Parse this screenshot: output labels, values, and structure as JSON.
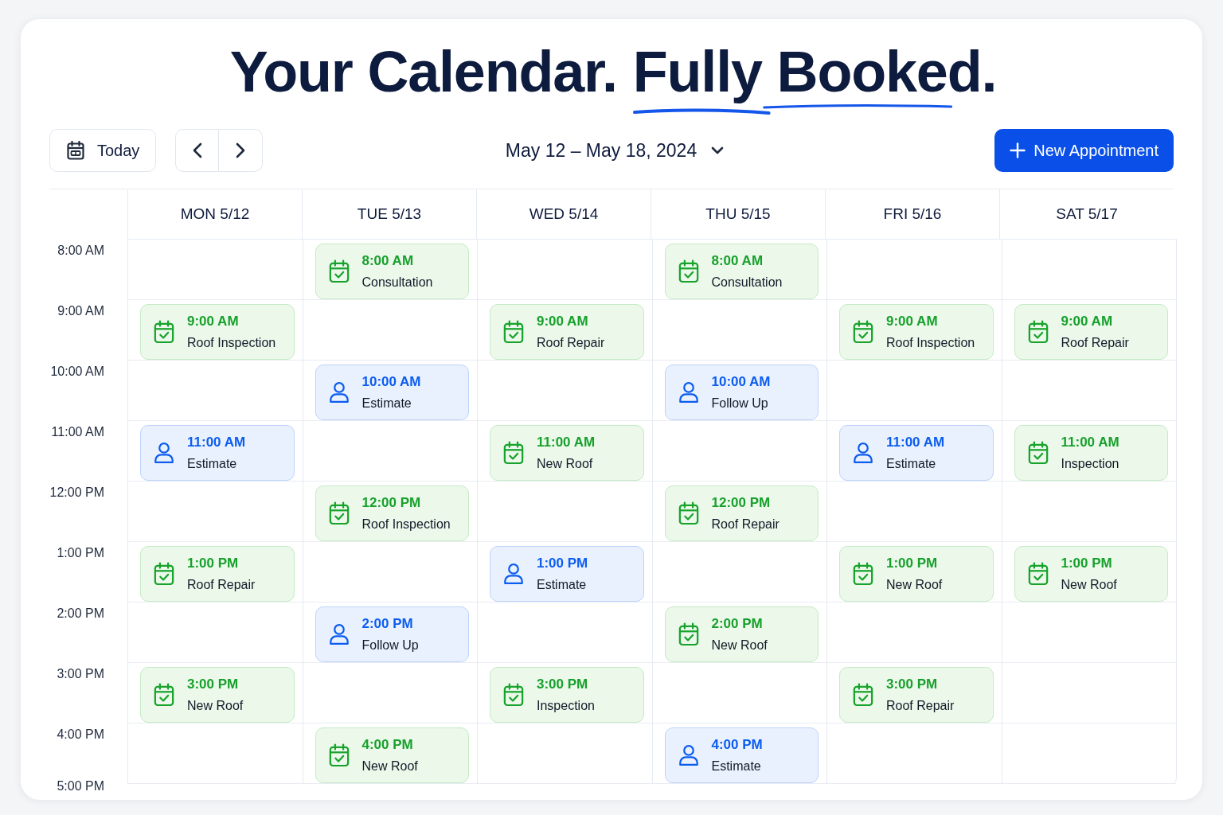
{
  "title": {
    "lead": "Your Calendar.",
    "highlight": "Fully Booked."
  },
  "toolbar": {
    "today_button": "Today",
    "date_range": "May 12 – May 18, 2024",
    "new_button": "New Appointment"
  },
  "calendar": {
    "time_labels": [
      "8:00 AM",
      "9:00 AM",
      "10:00 AM",
      "11:00 AM",
      "12:00 PM",
      "1:00 PM",
      "2:00 PM",
      "3:00 PM",
      "4:00 PM",
      "5:00 PM"
    ],
    "days": [
      {
        "label": "MON 5/12",
        "slots": [
          {
            "kind": "open"
          },
          {
            "kind": "service",
            "time": "9:00 AM",
            "title": "Roof Inspection"
          },
          {
            "kind": "open"
          },
          {
            "kind": "visit",
            "time": "11:00 AM",
            "title": "Estimate"
          },
          {
            "kind": "open"
          },
          {
            "kind": "service",
            "time": "1:00 PM",
            "title": "Roof Repair"
          },
          {
            "kind": "open"
          },
          {
            "kind": "service",
            "time": "3:00 PM",
            "title": "New Roof"
          },
          {
            "kind": "open"
          }
        ]
      },
      {
        "label": "TUE 5/13",
        "slots": [
          {
            "kind": "service",
            "time": "8:00 AM",
            "title": "Consultation"
          },
          {
            "kind": "open"
          },
          {
            "kind": "visit",
            "time": "10:00 AM",
            "title": "Estimate"
          },
          {
            "kind": "open"
          },
          {
            "kind": "service",
            "time": "12:00 PM",
            "title": "Roof Inspection"
          },
          {
            "kind": "open"
          },
          {
            "kind": "visit",
            "time": "2:00 PM",
            "title": "Follow Up"
          },
          {
            "kind": "open"
          },
          {
            "kind": "service",
            "time": "4:00 PM",
            "title": "New Roof"
          }
        ]
      },
      {
        "label": "WED 5/14",
        "slots": [
          {
            "kind": "open"
          },
          {
            "kind": "service",
            "time": "9:00 AM",
            "title": "Roof Repair"
          },
          {
            "kind": "open"
          },
          {
            "kind": "service",
            "time": "11:00 AM",
            "title": "New Roof"
          },
          {
            "kind": "open"
          },
          {
            "kind": "visit",
            "time": "1:00 PM",
            "title": "Estimate"
          },
          {
            "kind": "open"
          },
          {
            "kind": "service",
            "time": "3:00 PM",
            "title": "Inspection"
          },
          {
            "kind": "open"
          }
        ]
      },
      {
        "label": "THU 5/15",
        "slots": [
          {
            "kind": "service",
            "time": "8:00 AM",
            "title": "Consultation"
          },
          {
            "kind": "open"
          },
          {
            "kind": "visit",
            "time": "10:00 AM",
            "title": "Follow Up"
          },
          {
            "kind": "open"
          },
          {
            "kind": "service",
            "time": "12:00 PM",
            "title": "Roof Repair"
          },
          {
            "kind": "open"
          },
          {
            "kind": "service",
            "time": "2:00 PM",
            "title": "New Roof"
          },
          {
            "kind": "open"
          },
          {
            "kind": "visit",
            "time": "4:00 PM",
            "title": "Estimate"
          }
        ]
      },
      {
        "label": "FRI 5/16",
        "slots": [
          {
            "kind": "open"
          },
          {
            "kind": "service",
            "time": "9:00 AM",
            "title": "Roof Inspection"
          },
          {
            "kind": "open"
          },
          {
            "kind": "visit",
            "time": "11:00 AM",
            "title": "Estimate"
          },
          {
            "kind": "open"
          },
          {
            "kind": "service",
            "time": "1:00 PM",
            "title": "New Roof"
          },
          {
            "kind": "open"
          },
          {
            "kind": "service",
            "time": "3:00 PM",
            "title": "Roof Repair"
          },
          {
            "kind": "open"
          }
        ]
      },
      {
        "label": "SAT 5/17",
        "slots": [
          {
            "kind": "open"
          },
          {
            "kind": "service",
            "time": "9:00 AM",
            "title": "Roof Repair"
          },
          {
            "kind": "open"
          },
          {
            "kind": "service",
            "time": "11:00 AM",
            "title": "Inspection"
          },
          {
            "kind": "open"
          },
          {
            "kind": "service",
            "time": "1:00 PM",
            "title": "New Roof"
          },
          {
            "kind": "open"
          },
          {
            "kind": "open"
          },
          {
            "kind": "open"
          }
        ]
      }
    ]
  }
}
